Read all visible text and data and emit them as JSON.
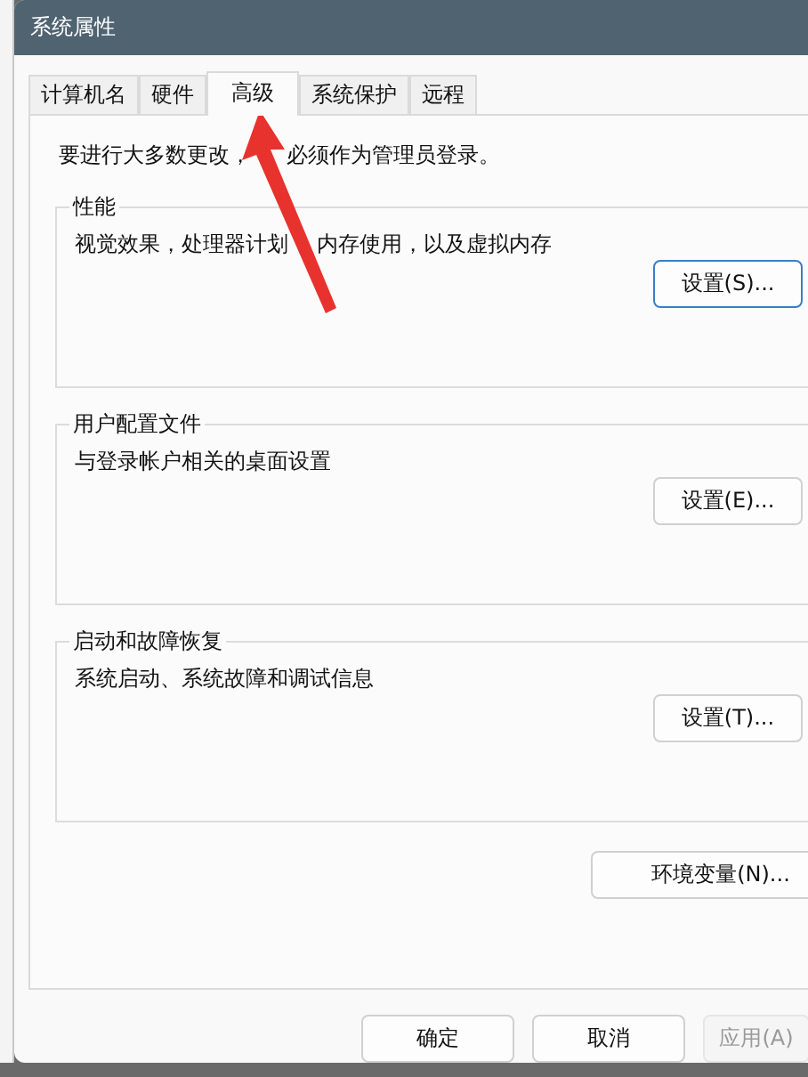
{
  "window": {
    "title": "系统属性"
  },
  "tabs": [
    {
      "label": "计算机名",
      "selected": false
    },
    {
      "label": "硬件",
      "selected": false
    },
    {
      "label": "高级",
      "selected": true
    },
    {
      "label": "系统保护",
      "selected": false
    },
    {
      "label": "远程",
      "selected": false
    }
  ],
  "notice": [
    "要进行大多数更改，",
    "必须作为管理员登录。"
  ],
  "groups": [
    {
      "title": "性能",
      "description": [
        "视觉效果，处理器计划",
        "内存使用，以及虚拟内存"
      ],
      "button": {
        "label": "设置(S)...",
        "focused": true
      }
    },
    {
      "title": "用户配置文件",
      "description": [
        "与登录帐户相关的桌面设置"
      ],
      "button": {
        "label": "设置(E)...",
        "focused": false
      }
    },
    {
      "title": "启动和故障恢复",
      "description": [
        "系统启动、系统故障和调试信息"
      ],
      "button": {
        "label": "设置(T)...",
        "focused": false
      }
    }
  ],
  "env_button": {
    "label": "环境变量(N)..."
  },
  "footer_buttons": [
    {
      "label": "确定",
      "disabled": false
    },
    {
      "label": "取消",
      "disabled": false
    },
    {
      "label": "应用(A)",
      "disabled": true
    }
  ]
}
